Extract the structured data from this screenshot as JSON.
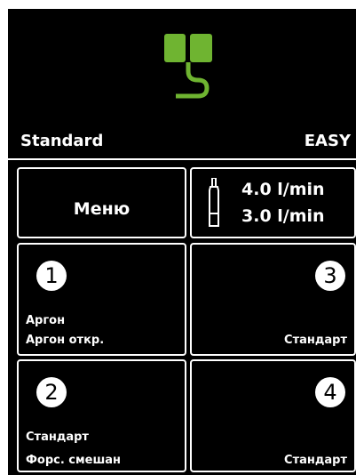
{
  "header": {
    "mode": "Standard",
    "program": "EASY"
  },
  "menu": {
    "label": "Меню"
  },
  "gas_flow": {
    "line1": "4.0 l/min",
    "line2": "3.0 l/min",
    "icon": "gas-bottle-icon"
  },
  "jobs": [
    {
      "number": "1",
      "line1": "Аргон",
      "line2": "Аргон откр."
    },
    {
      "number": "3",
      "line1": "",
      "line2": "Стандарт"
    },
    {
      "number": "2",
      "line1": "Стандарт",
      "line2": "Форс. смешан"
    },
    {
      "number": "4",
      "line1": "",
      "line2": "Стандарт"
    }
  ],
  "colors": {
    "accent": "#6fb431",
    "background": "#000000",
    "foreground": "#ffffff"
  }
}
